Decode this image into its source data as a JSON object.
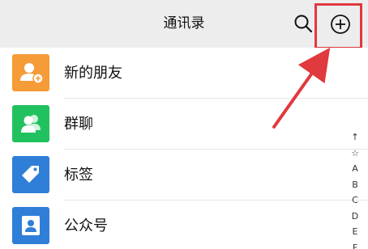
{
  "header": {
    "title": "通讯录",
    "search_icon": "search-icon",
    "add_icon": "add-circle-icon"
  },
  "contacts": [
    {
      "label": "新的朋友",
      "icon": "add-friend-icon",
      "color": "#f59b38"
    },
    {
      "label": "群聊",
      "icon": "group-chat-icon",
      "color": "#21c15f"
    },
    {
      "label": "标签",
      "icon": "tag-icon",
      "color": "#2f7ed8"
    },
    {
      "label": "公众号",
      "icon": "official-account-icon",
      "color": "#2f7ed8"
    }
  ],
  "index": [
    "↑",
    "☆",
    "A",
    "B",
    "C",
    "D",
    "E",
    "F"
  ],
  "colors": {
    "header_bg": "#ededed",
    "highlight": "#e0393e",
    "arrow": "#e0393e"
  }
}
